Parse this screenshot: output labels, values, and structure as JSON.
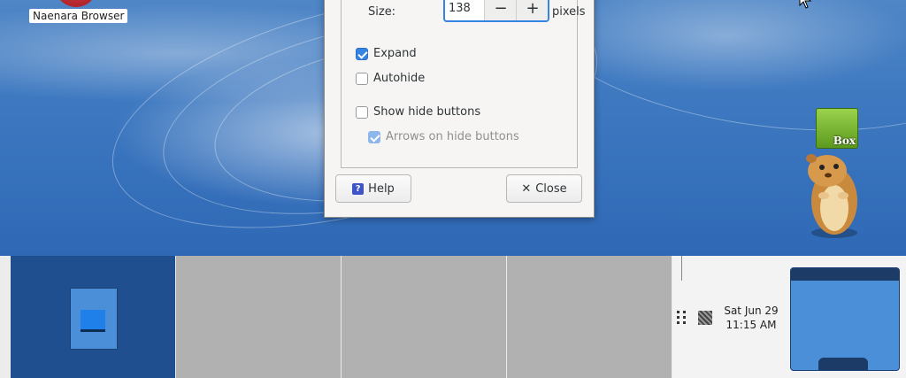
{
  "desktop": {
    "icons": [
      {
        "label": "Naenara Browser",
        "icon": "browser-icon"
      },
      {
        "label": "Box",
        "icon": "gbox-icon"
      }
    ]
  },
  "dialog": {
    "size_label": "Size:",
    "size_value": "138",
    "size_unit": "pixels",
    "checkboxes": [
      {
        "label": "Expand",
        "checked": true,
        "enabled": true
      },
      {
        "label": "Autohide",
        "checked": false,
        "enabled": true
      },
      {
        "label": "Show hide buttons",
        "checked": false,
        "enabled": true
      },
      {
        "label": "Arrows on hide buttons",
        "checked": true,
        "enabled": false
      }
    ],
    "help_label": "Help",
    "close_label": "Close"
  },
  "panel": {
    "clock_date": "Sat Jun 29",
    "clock_time": "11:15 AM",
    "workspaces": 4,
    "active_workspace": 1
  },
  "colors": {
    "accent": "#3584e4",
    "active_workspace": "#1f4f8e",
    "inactive_workspace": "#b1b1b1"
  }
}
